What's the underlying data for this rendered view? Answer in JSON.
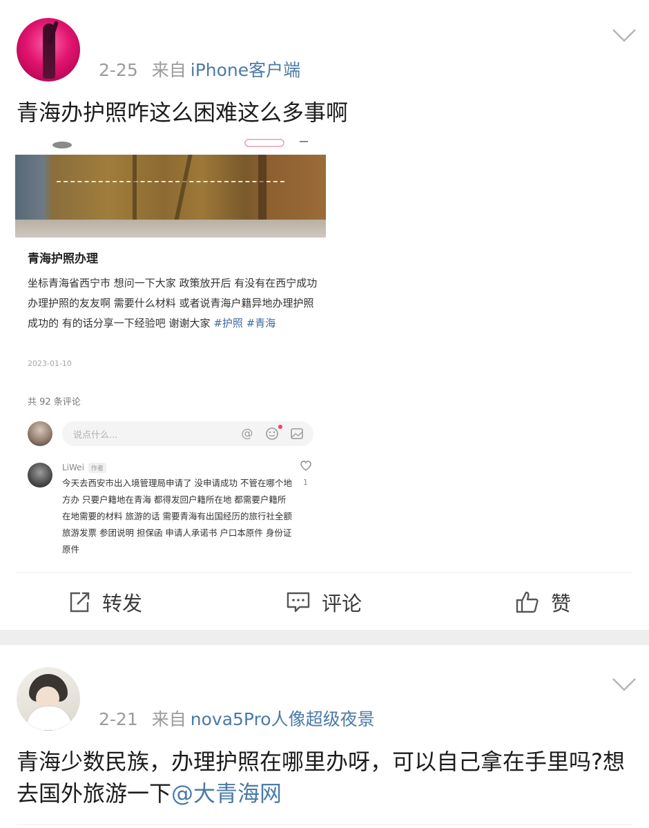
{
  "posts": [
    {
      "time": "2-25",
      "source_prefix": "来自",
      "source": "iPhone客户端",
      "text": "青海办护照咋这么困难这么多事啊",
      "embed": {
        "title": "青海护照办理",
        "body": "坐标青海省西宁市 想问一下大家 政策放开后 有没有在西宁成功办理护照的友友啊 需要什么材料 或者说青海户籍异地办理护照成功的 有的话分享一下经验吧 谢谢大家",
        "tags": [
          "#护照",
          "#青海"
        ],
        "date": "2023-01-10",
        "comment_count": "共 92 条评论",
        "input_placeholder": "说点什么...",
        "comment": {
          "author": "LiWei",
          "author_badge": "作者",
          "text": "今天去西安市出入境管理局申请了 没申请成功 不管在哪个地方办 只要户籍地在青海 都得发回户籍所在地 都需要户籍所在地需要的材料 旅游的话 需要青海有出国经历的旅行社全额旅游发票 参团说明 担保函 申请人承诺书 户口本原件 身份证原件",
          "likes": "1"
        }
      },
      "actions": {
        "repost": "转发",
        "comment": "评论",
        "like": "赞"
      }
    },
    {
      "time": "2-21",
      "source_prefix": "来自",
      "source": "nova5Pro人像超级夜景",
      "text": "青海少数民族，办理护照在哪里办呀，可以自己拿在手里吗?想去国外旅游一下",
      "mention": "@大青海网"
    }
  ],
  "colors": {
    "link": "#4b7aa8",
    "meta": "#9b9b9b",
    "text": "#1c1c1c"
  }
}
